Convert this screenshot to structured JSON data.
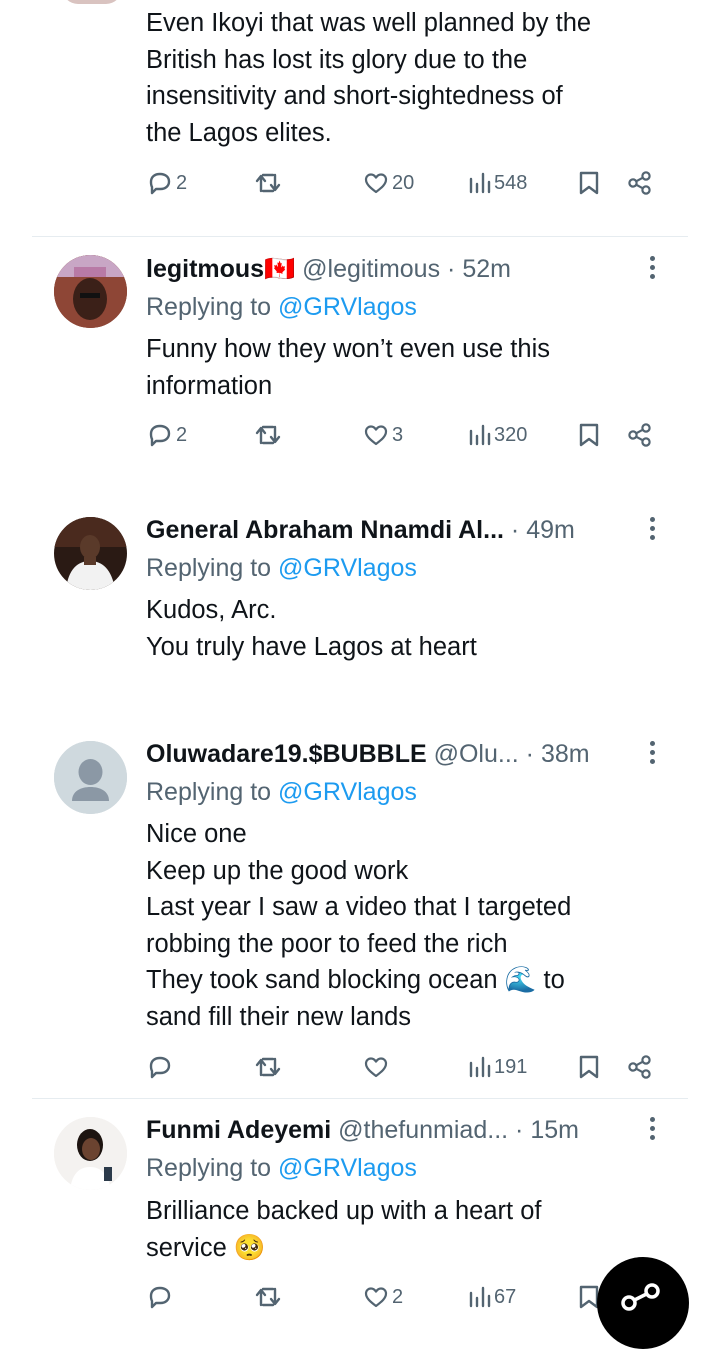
{
  "tweets": [
    {
      "lines": [
        "Even Ikoyi that was well planned by the",
        "British has lost its glory due to the",
        "insensitivity and short-sightedness of",
        "the Lagos elites."
      ],
      "replies": "2",
      "retweets": "",
      "likes": "20",
      "views": "548"
    },
    {
      "name": "legitmous🇨🇦",
      "handle": "@legitimous",
      "time": "52m",
      "replying_prefix": "Replying to",
      "replying_to": "@GRVlagos",
      "lines": [
        "Funny how they won’t even use this",
        "information"
      ],
      "replies": "2",
      "retweets": "",
      "likes": "3",
      "views": "320"
    },
    {
      "name": "General Abraham Nnamdi Al...",
      "handle": "",
      "time": "49m",
      "replying_prefix": "Replying to",
      "replying_to": "@GRVlagos",
      "lines": [
        "Kudos, Arc.",
        "You truly have Lagos at heart"
      ]
    },
    {
      "name": "Oluwadare19.$BUBBLE",
      "handle": "@Olu...",
      "time": "38m",
      "replying_prefix": "Replying to",
      "replying_to": "@GRVlagos",
      "lines": [
        "Nice one",
        "Keep up the good work",
        "Last year I saw a video that I targeted",
        "robbing the poor to feed the rich",
        "They took sand blocking ocean 🌊 to",
        "sand fill their new lands"
      ],
      "replies": "",
      "retweets": "",
      "likes": "",
      "views": "191"
    },
    {
      "name": "Funmi Adeyemi",
      "handle": "@thefunmiad...",
      "time": "15m",
      "replying_prefix": "Replying to",
      "replying_to": "@GRVlagos",
      "lines": [
        "Brilliance backed up with a heart of",
        "service 🥺"
      ],
      "replies": "",
      "retweets": "",
      "likes": "2",
      "views": "67"
    }
  ],
  "icons": {
    "reply": "reply-icon",
    "retweet": "retweet-icon",
    "like": "heart-icon",
    "views": "views-icon",
    "bookmark": "bookmark-icon",
    "share": "share-icon",
    "more": "more-icon",
    "fab": "share-fab-icon"
  },
  "colors": {
    "link": "#1d9bf0",
    "muted": "#536471",
    "text": "#0f1419",
    "fab": "#000000"
  }
}
